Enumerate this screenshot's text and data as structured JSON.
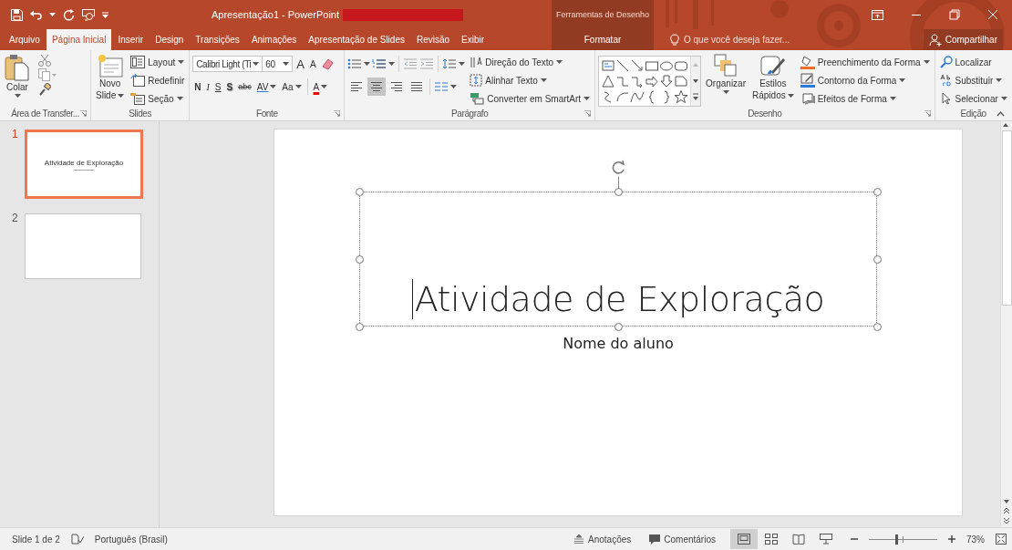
{
  "window": {
    "title": "Apresentação1 - PowerPoint",
    "context_group": "Ferramentas de Desenho"
  },
  "tabs": [
    {
      "label": "Arquivo",
      "selected": false,
      "kind": "file"
    },
    {
      "label": "Página Inicial",
      "selected": true,
      "kind": "normal"
    },
    {
      "label": "Inserir",
      "selected": false,
      "kind": "normal"
    },
    {
      "label": "Design",
      "selected": false,
      "kind": "normal"
    },
    {
      "label": "Transições",
      "selected": false,
      "kind": "normal"
    },
    {
      "label": "Animações",
      "selected": false,
      "kind": "normal"
    },
    {
      "label": "Apresentação de Slides",
      "selected": false,
      "kind": "normal"
    },
    {
      "label": "Revisão",
      "selected": false,
      "kind": "normal"
    },
    {
      "label": "Exibir",
      "selected": false,
      "kind": "normal"
    },
    {
      "label": "Formatar",
      "selected": false,
      "kind": "context"
    }
  ],
  "tell_me": {
    "placeholder": "O que você deseja fazer..."
  },
  "share": "Compartilhar",
  "clipboard": {
    "label": "Área de Transfer...",
    "paste": "Colar"
  },
  "slides_group": {
    "label": "Slides",
    "new_slide": [
      "Novo",
      "Slide"
    ],
    "items": [
      "Layout",
      "Redefinir",
      "Seção"
    ]
  },
  "font": {
    "label": "Fonte",
    "font_name": "Calibri Light (Ti",
    "font_size": "60",
    "grow": "A",
    "shrink": "A",
    "bold": "N",
    "italic": "I",
    "underline": "S",
    "shadow": "S",
    "strike": "abc",
    "spacing": "AV",
    "case": "Aa",
    "color_letter": "A"
  },
  "paragraph": {
    "label": "Parágrafo",
    "align": [
      {
        "kind": "left",
        "selected": false
      },
      {
        "kind": "center",
        "selected": true
      },
      {
        "kind": "right",
        "selected": false
      },
      {
        "kind": "justify",
        "selected": false
      }
    ],
    "items": [
      "Direção do Texto",
      "Alinhar Texto",
      "Converter em SmartArt"
    ]
  },
  "drawing": {
    "label": "Desenho",
    "arrange": "Organizar",
    "quick_styles": [
      "Estilos",
      "Rápidos"
    ],
    "items": [
      "Preenchimento da Forma",
      "Contorno da Forma",
      "Efeitos de Forma"
    ]
  },
  "editing": {
    "label": "Edição",
    "items": [
      "Localizar",
      "Substituir",
      "Selecionar"
    ]
  },
  "thumbnails": [
    {
      "number": "1",
      "selected": true,
      "title": "Atividade de Exploração"
    },
    {
      "number": "2",
      "selected": false
    }
  ],
  "slide": {
    "title": "Atividade de Exploração",
    "subtitle": "Nome do aluno"
  },
  "status_bar": {
    "slide_count": "Slide 1 de 2",
    "language": "Português (Brasil)",
    "notes": "Anotações",
    "comments": "Comentários",
    "views": [
      {
        "kind": "normal",
        "selected": true
      },
      {
        "kind": "sorter",
        "selected": false
      },
      {
        "kind": "reading",
        "selected": false
      },
      {
        "kind": "show",
        "selected": false
      }
    ],
    "zoom": {
      "level": 0.4,
      "reading": "73%"
    }
  }
}
